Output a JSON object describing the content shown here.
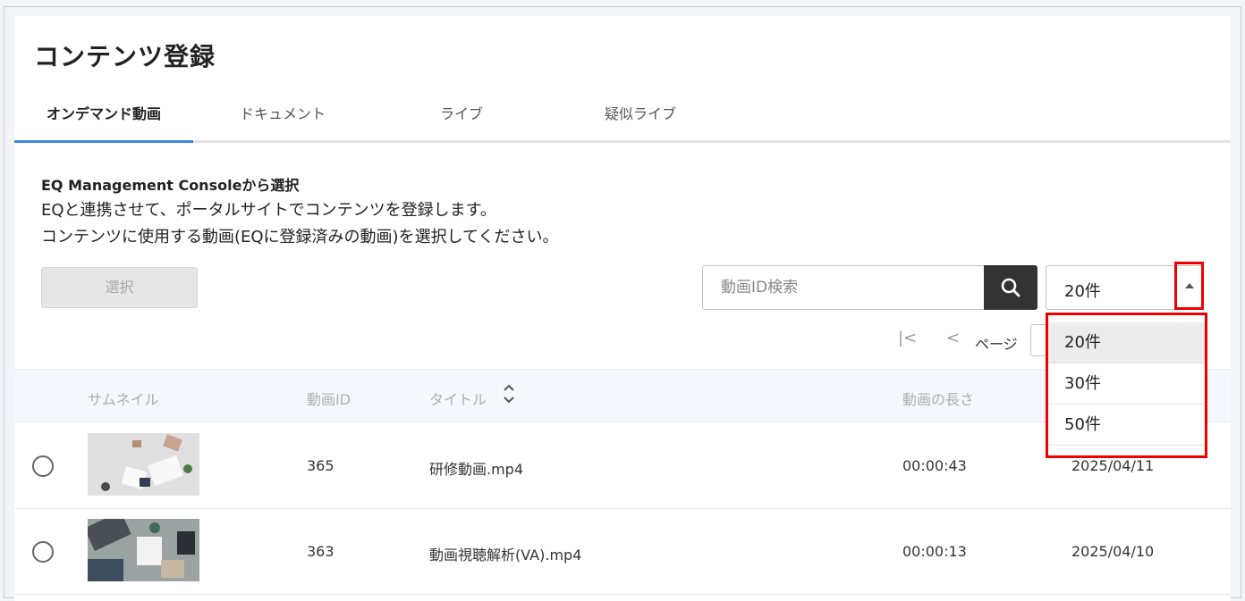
{
  "page": {
    "title": "コンテンツ登録"
  },
  "tabs": [
    {
      "label": "オンデマンド動画",
      "active": true
    },
    {
      "label": "ドキュメント",
      "active": false
    },
    {
      "label": "ライブ",
      "active": false
    },
    {
      "label": "疑似ライブ",
      "active": false
    }
  ],
  "description": {
    "title": "EQ Management Consoleから選択",
    "line1": "EQと連携させて、ポータルサイトでコンテンツを登録します。",
    "line2": "コンテンツに使用する動画(EQに登録済みの動画)を選択してください。"
  },
  "actions": {
    "select_label": "選択"
  },
  "search": {
    "placeholder": "動画ID検索",
    "icon": "search-icon"
  },
  "per_page": {
    "value": "20件",
    "options": [
      "20件",
      "30件",
      "50件"
    ],
    "selected_index": 0
  },
  "pagination": {
    "first_icon": "|<",
    "prev_icon": "<",
    "page_label": "ページ"
  },
  "table": {
    "headers": {
      "thumbnail": "サムネイル",
      "video_id": "動画ID",
      "title": "タイトル",
      "duration": "動画の長さ"
    },
    "rows": [
      {
        "video_id": "365",
        "title": "研修動画.mp4",
        "duration": "00:00:43",
        "date": "2025/04/11"
      },
      {
        "video_id": "363",
        "title": "動画視聴解析(VA).mp4",
        "duration": "00:00:13",
        "date": "2025/04/10"
      }
    ]
  },
  "colors": {
    "accent": "#3b8ad8",
    "highlight": "#ee0000",
    "search_button": "#333333"
  }
}
